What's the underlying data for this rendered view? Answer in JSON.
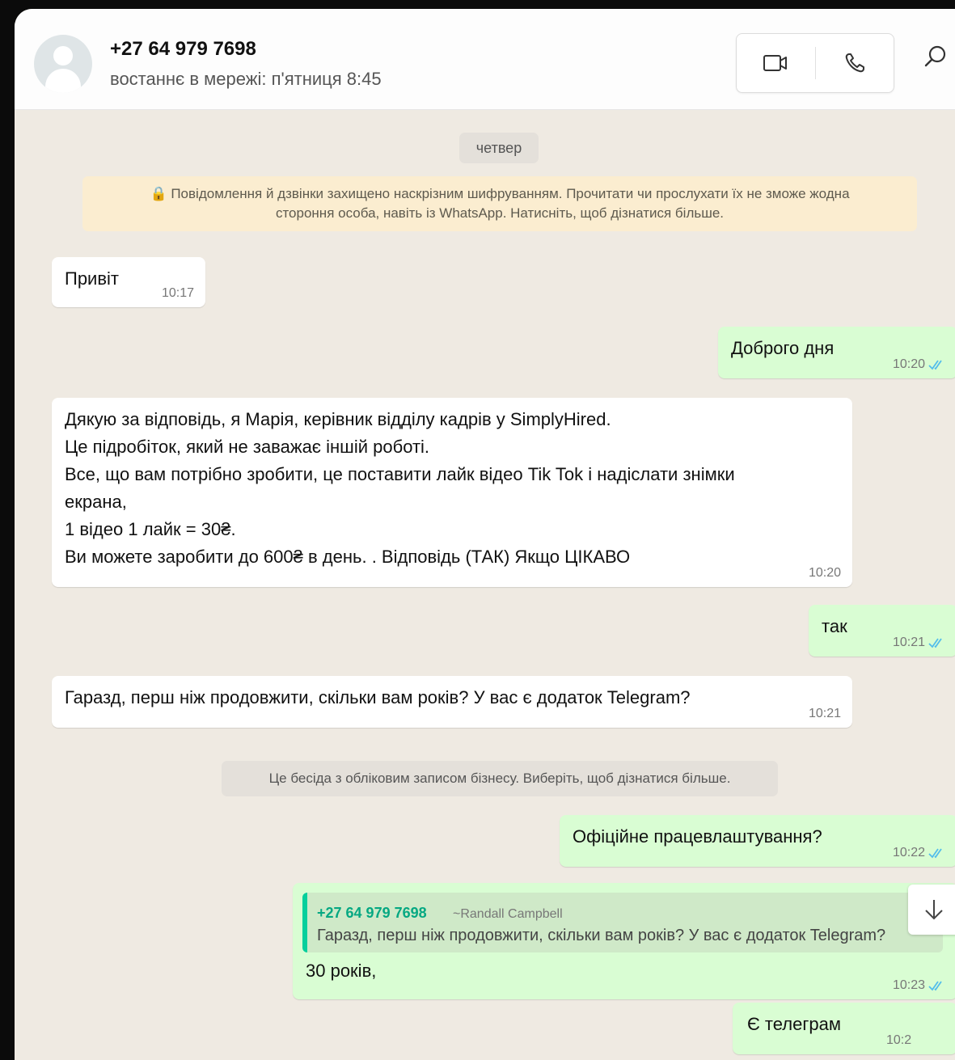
{
  "header": {
    "contact_name": "+27 64 979 7698",
    "last_seen": "востаннє в мережі: п'ятниця 8:45",
    "icons": [
      "avatar-icon",
      "video-call-icon",
      "voice-call-icon",
      "search-icon"
    ]
  },
  "chat": {
    "day_label": "четвер",
    "encryption_notice": "🔒 Повідомлення й дзвінки захищено наскрізним шифруванням. Прочитати чи прослухати їх не зможе жодна\nстороння особа, навіть із WhatsApp. Натисніть, щоб дізнатися більше.",
    "business_notice": "Це бесіда з обліковим записом бізнесу. Виберіть, щоб дізнатися більше.",
    "messages": [
      {
        "text": "Привіт",
        "time": "10:17",
        "direction": "in"
      },
      {
        "text": "Доброго дня",
        "time": "10:20",
        "direction": "out",
        "status": "read"
      },
      {
        "text": "Дякую за відповідь, я Марія, керівник відділу кадрів у SimplyHired.\nЦе підробіток, який не заважає іншій роботі.\nВсе, що вам потрібно зробити, це поставити лайк відео Tik Tok і надіслати знімки\nекрана,\n1 відео 1 лайк = 30₴.\nВи можете заробити до 600₴ в день. . Відповідь (ТАК) Якщо ЦІКАВО",
        "time": "10:20",
        "direction": "in"
      },
      {
        "text": "так",
        "time": "10:21",
        "direction": "out",
        "status": "read"
      },
      {
        "text": "Гаразд, перш ніж продовжити, скільки вам років? У вас є додаток Telegram?",
        "time": "10:21",
        "direction": "in"
      },
      {
        "text": "Офіційне працевлаштування?",
        "time": "10:22",
        "direction": "out",
        "status": "read"
      },
      {
        "text": "30 років,",
        "time": "10:23",
        "direction": "out",
        "status": "read",
        "reply": {
          "author": "+27 64 979 7698",
          "alias": "~Randall Campbell",
          "text": "Гаразд, перш ніж продовжити, скільки вам років? У вас є додаток Telegram?"
        }
      },
      {
        "text": "Є телеграм",
        "time": "10:2",
        "direction": "out",
        "status": "read"
      }
    ]
  },
  "colors": {
    "incoming_bubble": "#ffffff",
    "outgoing_bubble": "#d9fdd3",
    "read_ticks": "#53bdeb",
    "chat_background": "#efeae2",
    "notice_background": "#fbedd0"
  }
}
